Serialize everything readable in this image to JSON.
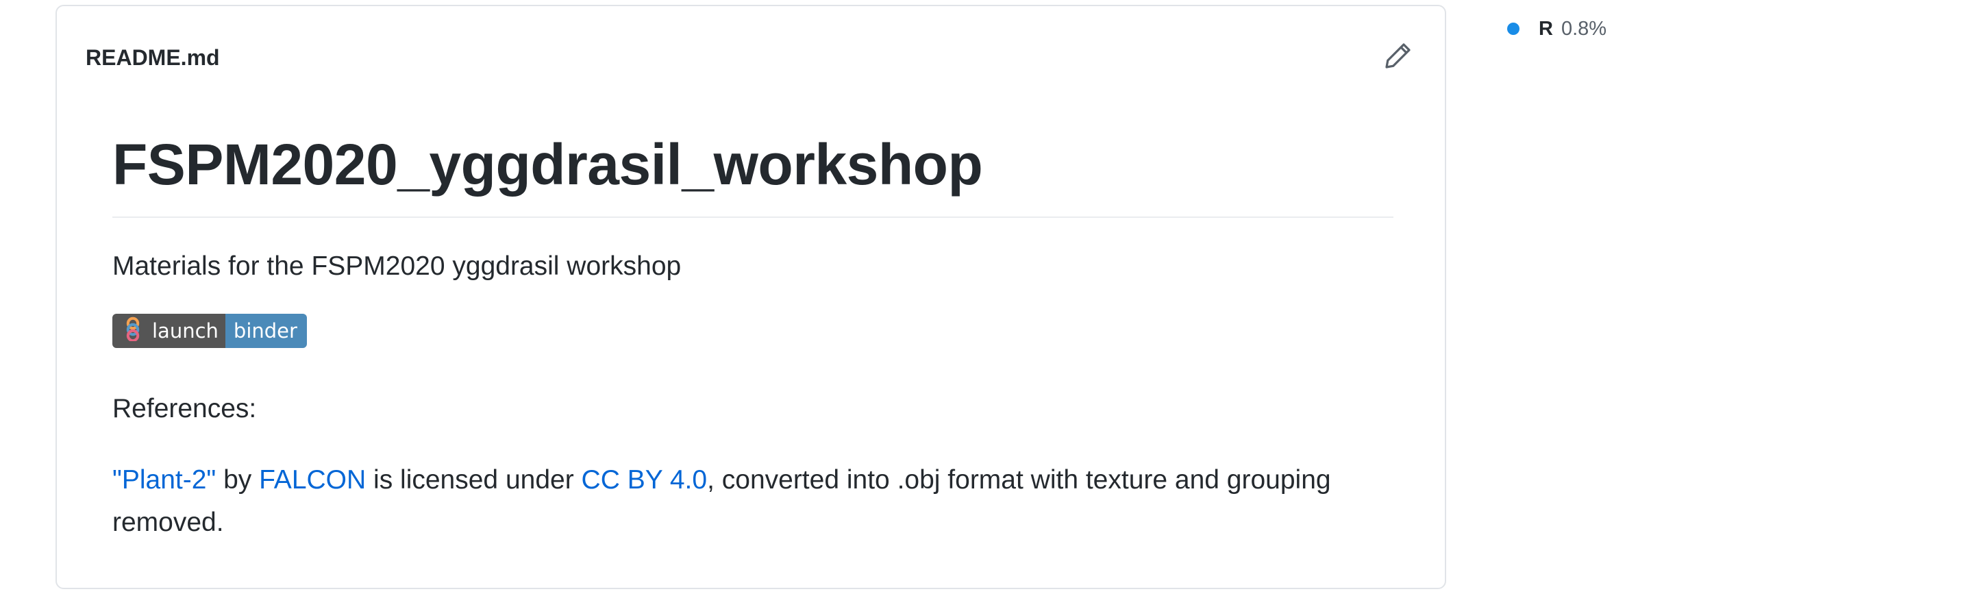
{
  "readme": {
    "filename": "README.md",
    "title": "FSPM2020_yggdrasil_workshop",
    "description": "Materials for the FSPM2020 yggdrasil workshop",
    "badge": {
      "left_label": "launch",
      "right_label": "binder"
    },
    "references_heading": "References:",
    "license": {
      "link_work": "\"Plant-2\"",
      "text_by": " by ",
      "link_author": "FALCON",
      "text_licensed": " is licensed under ",
      "link_license": "CC BY 4.0",
      "text_rest": ", converted into .obj format with texture and grouping removed."
    }
  },
  "languages": [
    {
      "name": "R",
      "percent": "0.8%",
      "color": "#198ce7"
    }
  ],
  "colors": {
    "link": "#0366d6",
    "badge_left": "#555555",
    "badge_right": "#4b8ab9",
    "border": "#e1e4e8"
  }
}
